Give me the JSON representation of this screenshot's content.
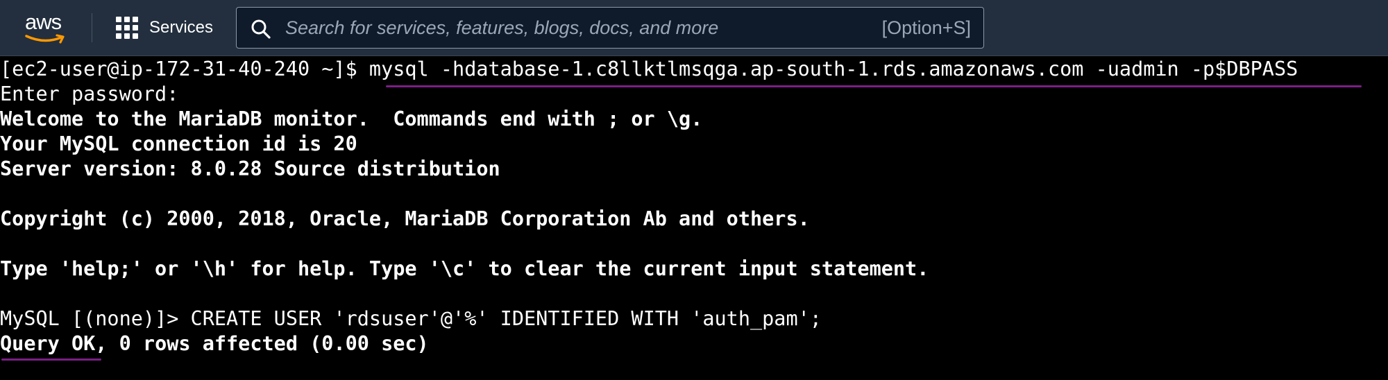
{
  "header": {
    "logo_text": "aws",
    "services_label": "Services",
    "search": {
      "placeholder": "Search for services, features, blogs, docs, and more",
      "value": "",
      "shortcut": "[Option+S]"
    },
    "colors": {
      "bar": "#232f3e",
      "logo_smile": "#ff9900"
    }
  },
  "terminal": {
    "prompt": "[ec2-user@ip-172-31-40-240 ~]$ ",
    "command": "mysql -hdatabase-1.c8llktlmsqga.ap-south-1.rds.amazonaws.com -uadmin -p$DBPASS",
    "output": [
      "Enter password:",
      "Welcome to the MariaDB monitor.  Commands end with ; or \\g.",
      "Your MySQL connection id is 20",
      "Server version: 8.0.28 Source distribution",
      "",
      "Copyright (c) 2000, 2018, Oracle, MariaDB Corporation Ab and others.",
      "",
      "Type 'help;' or '\\h' for help. Type '\\c' to clear the current input statement.",
      ""
    ],
    "mysql_prompt": "MySQL [(none)]> ",
    "sql_command": "CREATE USER 'rdsuser'@'%' IDENTIFIED WITH 'auth_pam';",
    "result_ok": "Query OK",
    "result_rest": ", 0 rows affected (0.00 sec)",
    "colors": {
      "background": "#000000",
      "text": "#ffffff",
      "annotation_underline": "#7b1f86"
    }
  }
}
